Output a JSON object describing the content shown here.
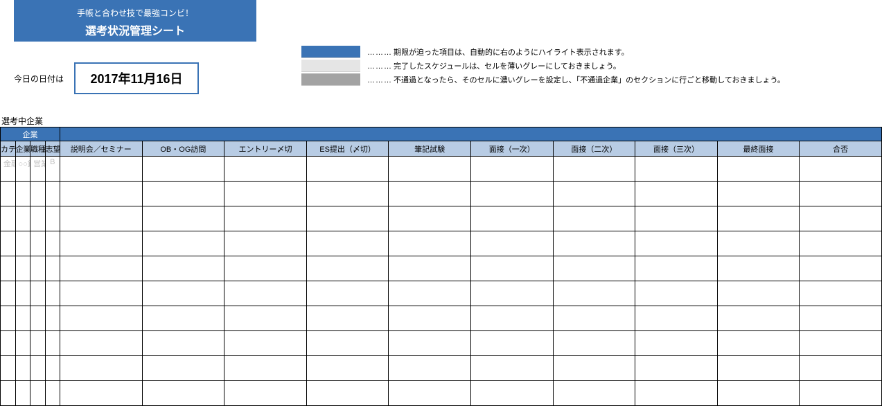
{
  "header": {
    "subtitle": "手帳と合わせ技で最強コンビ！",
    "title": "選考状況管理シート"
  },
  "date": {
    "label": "今日の日付は",
    "value": "2017年11月16日"
  },
  "legend": [
    {
      "text": "期限が迫った項目は、自動的に右のようにハイライト表示されます。"
    },
    {
      "text": "完了したスケジュールは、セルを薄いグレーにしておきましょう。"
    },
    {
      "text": "不通過となったら、そのセルに濃いグレーを設定し、「不通過企業」のセクションに行ごと移動しておきましょう。"
    }
  ],
  "section_ongoing": "選考中企業",
  "table": {
    "group_header": "企業",
    "columns_left": {
      "category": "カテゴリ",
      "company": "企業名",
      "jobtype": "職種",
      "rank": "志望度（A～E）"
    },
    "columns_right": [
      "説明会／セミナー",
      "OB・OG訪問",
      "エントリー〆切",
      "ES提出（〆切）",
      "筆記試験",
      "面接（一次）",
      "面接（二次）",
      "面接（三次）",
      "最終面接",
      "合否"
    ],
    "example_row": {
      "category": "金融",
      "company": "○○銀行",
      "jobtype": "営業",
      "rank": "B"
    }
  }
}
